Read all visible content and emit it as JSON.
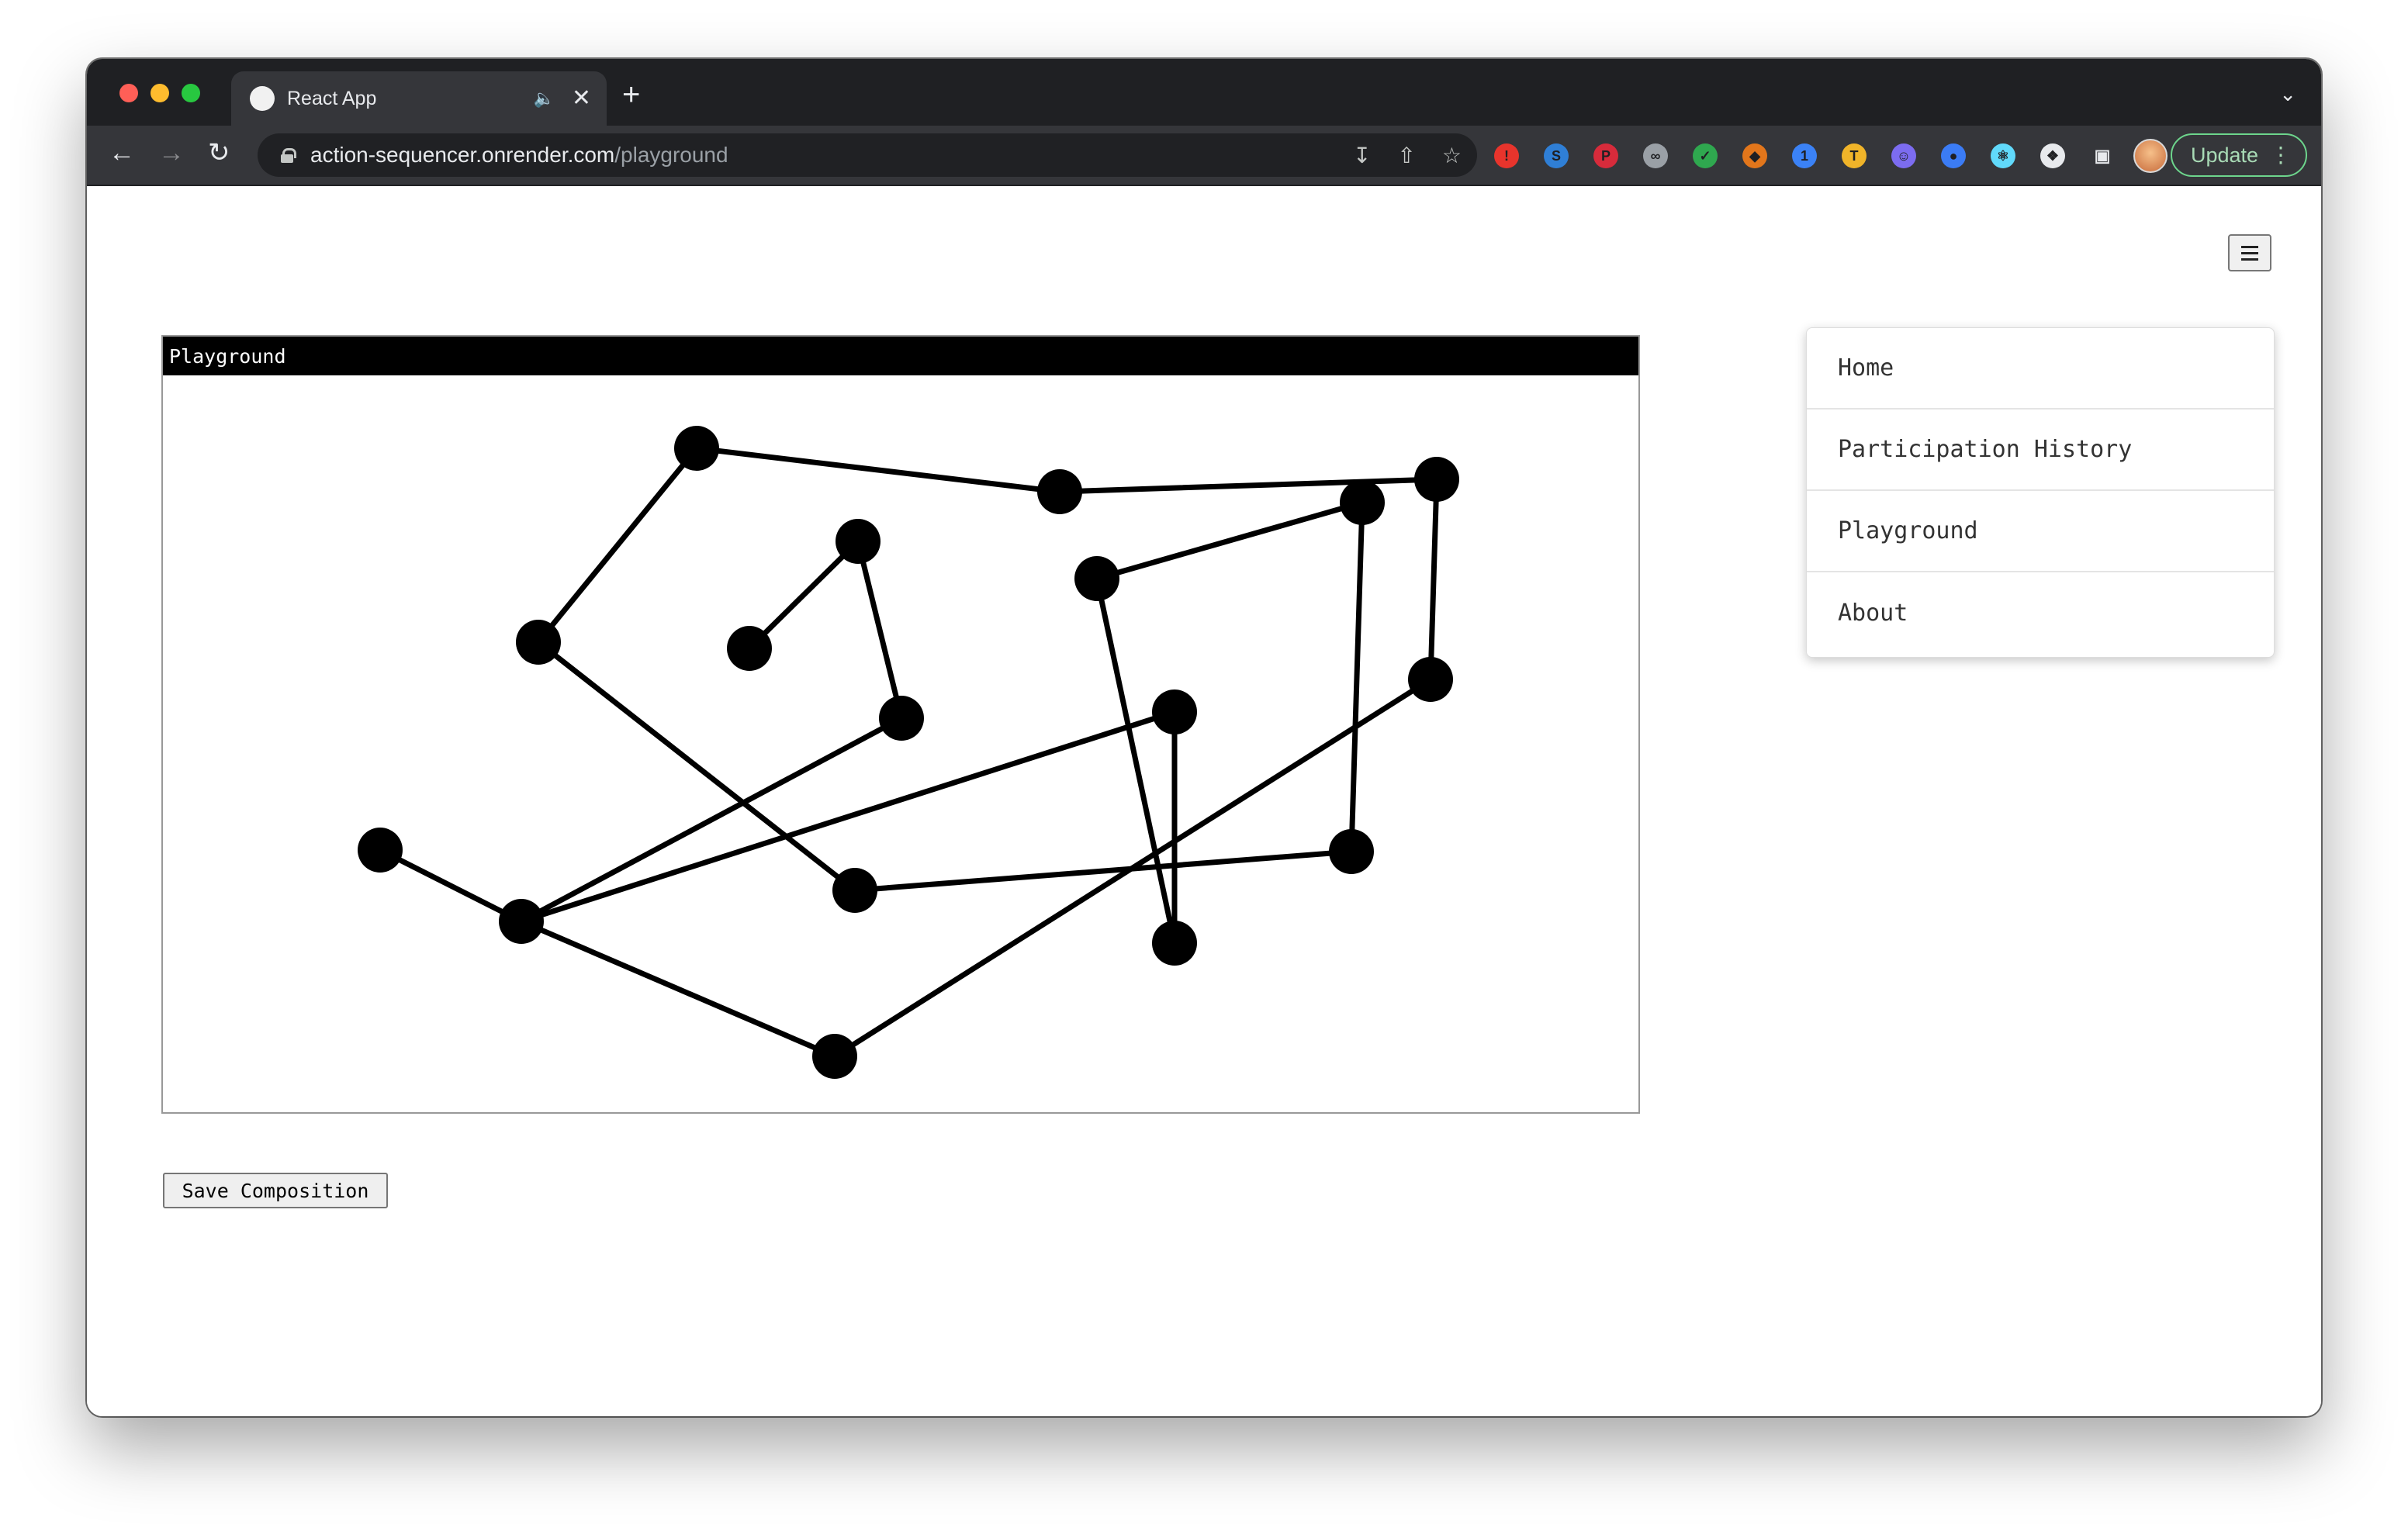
{
  "browser": {
    "tab_title": "React App",
    "url_host": "action-sequencer.onrender.com",
    "url_path": "/playground",
    "update_label": "Update",
    "extensions": [
      {
        "icon": "adblock-icon",
        "color": "#e8342c"
      },
      {
        "icon": "s-extension-icon",
        "color": "#2f7fd6"
      },
      {
        "icon": "pinterest-icon",
        "color": "#d72b3b"
      },
      {
        "icon": "glasses-icon",
        "color": "#9aa0a6"
      },
      {
        "icon": "checkmark-icon",
        "color": "#2fa84f"
      },
      {
        "icon": "metamask-icon",
        "color": "#e2761b"
      },
      {
        "icon": "password-manager-icon",
        "color": "#3b82f6"
      },
      {
        "icon": "tool-icon",
        "color": "#f0b429"
      },
      {
        "icon": "face-icon",
        "color": "#7c6cf0"
      },
      {
        "icon": "drop-icon",
        "color": "#3b7cf5"
      },
      {
        "icon": "react-icon",
        "color": "#61dafb"
      },
      {
        "icon": "puzzle-icon",
        "color": "#e8eaed"
      }
    ]
  },
  "playground": {
    "title": "Playground",
    "save_label": "Save Composition"
  },
  "nav_menu": {
    "items": [
      "Home",
      "Participation History",
      "Playground",
      "About"
    ]
  }
}
